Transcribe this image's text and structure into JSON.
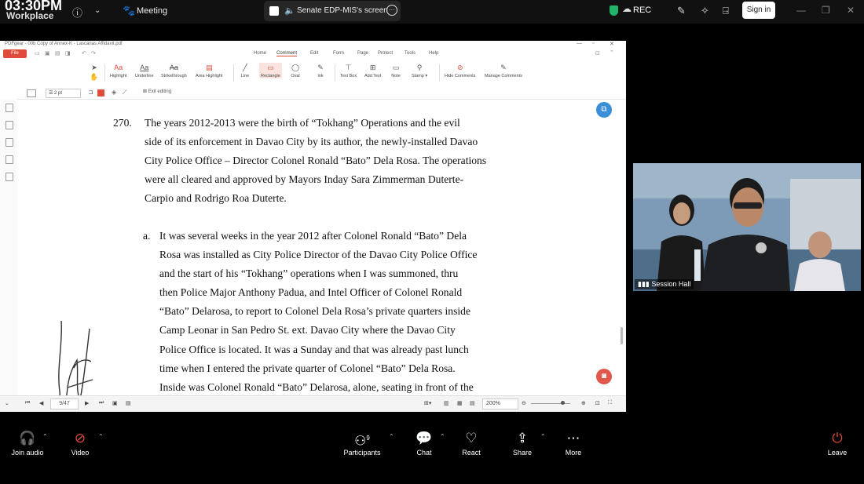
{
  "top_bar": {
    "clock": "03:30PM",
    "app_name": "Workplace",
    "meeting_label": "Meeting",
    "share_label": "Senate EDP-MIS's screen",
    "rec_label": "REC",
    "signin_label": "Sign in"
  },
  "pdf_app": {
    "window_title": "PDFgear - 00b Copy of Annex-K - Lascanas Affidavit.pdf",
    "file_button": "File",
    "menus": [
      "Home",
      "Comment",
      "Edit",
      "Form",
      "Page",
      "Protect",
      "Tools",
      "Help"
    ],
    "active_menu": "Comment",
    "tools": [
      "Highlight",
      "Underline",
      "Strikethrough",
      "Area Highlight",
      "Line",
      "Rectangle",
      "Oval",
      "Ink",
      "Text Box",
      "Add Text",
      "Note",
      "Stamp",
      "Hide Comments",
      "Manage Comments"
    ],
    "selected_tool": "Rectangle",
    "stroke_width": "2 pt",
    "exit_editing": "Exit editing",
    "page_indicator": "9/47",
    "zoom": "200%",
    "paragraph_270_number": "270.",
    "paragraph_270_lines": [
      "The years 2012-2013 were the birth of “Tokhang” Operations and the evil",
      "side of its enforcement in Davao City by its author, the newly-installed Davao",
      "City Police Office – Director Colonel Ronald “Bato” Dela Rosa. The operations",
      "were all cleared and approved by Mayors Inday Sara Zimmerman Duterte-",
      "Carpio and Rodrigo Roa Duterte."
    ],
    "sub_a_letter": "a.",
    "sub_a_lines": [
      "It was several weeks in the year 2012 after Colonel Ronald “Bato” Dela",
      "Rosa was installed as City Police Director of the Davao City Police Office",
      "and the start of his “Tokhang” operations when I was summoned, thru",
      "then Police Major Anthony Padua, and Intel Officer of Colonel Ronald",
      "“Bato” Delarosa, to report to Colonel Dela Rosa’s private quarters inside",
      "Camp Leonar in San Pedro St. ext. Davao City where the Davao City",
      "Police Office is located. It was a Sunday and that was already past lunch",
      "time when I entered the private quarter of Colonel “Bato” Dela Rosa.",
      "Inside was Colonel Ronald “Bato” Delarosa, alone, seating in front of the"
    ]
  },
  "video_tile": {
    "name": "Session Hall"
  },
  "bottom_bar": {
    "join_audio": "Join audio",
    "video": "Video",
    "participants": "Participants",
    "participants_count": "9",
    "chat": "Chat",
    "react": "React",
    "share": "Share",
    "more": "More",
    "leave": "Leave"
  },
  "colors": {
    "accent_red": "#e04c3c",
    "shield_green": "#1fb46a",
    "fab_blue": "#3a8fd8",
    "fab_red": "#e2574c"
  },
  "icons": [
    "info-icon",
    "chevron-down-icon",
    "paw-icon",
    "speaker-icon",
    "more-icon",
    "shield-icon",
    "cloud-icon",
    "pen-icon",
    "sparkle-icon",
    "door-icon",
    "headphones-icon",
    "camera-off-icon",
    "people-icon",
    "chat-icon",
    "heart-icon",
    "share-icon",
    "ellipsis-icon",
    "leave-icon"
  ]
}
